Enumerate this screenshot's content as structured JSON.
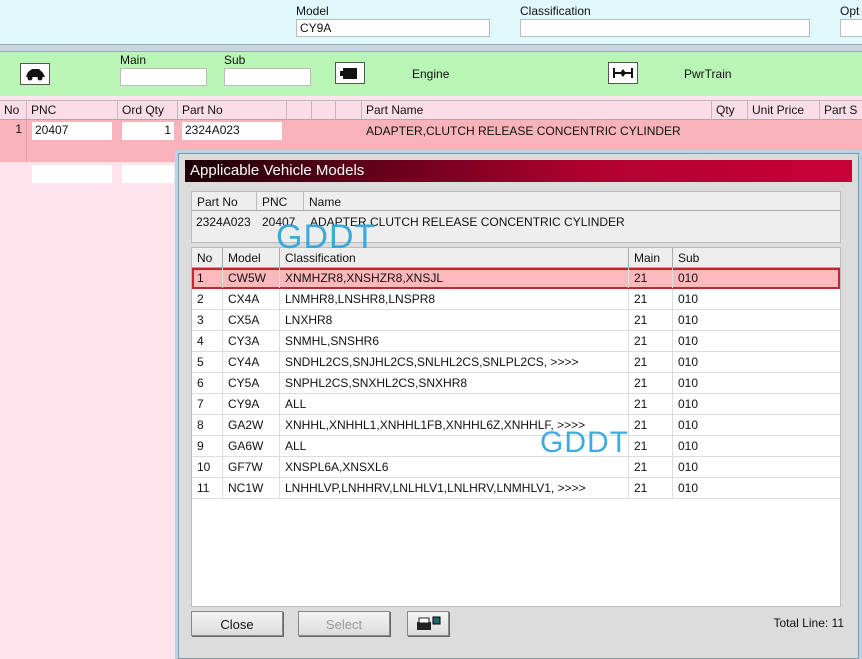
{
  "top": {
    "model_label": "Model",
    "model_value": "CY9A",
    "classification_label": "Classification",
    "classification_value": "",
    "opt_label": "Opt"
  },
  "filter": {
    "main_label": "Main",
    "sub_label": "Sub",
    "engine_label": "Engine",
    "pwrtrain_label": "PwrTrain"
  },
  "grid": {
    "headers": [
      "No",
      "PNC",
      "Ord Qty",
      "Part No",
      "",
      "",
      "",
      "Part Name",
      "Qty",
      "Unit Price",
      "Part S"
    ],
    "row": {
      "no": "1",
      "pnc": "20407",
      "ord_qty": "1",
      "part_no": "2324A023",
      "part_name": "ADAPTER,CLUTCH RELEASE CONCENTRIC CYLINDER"
    }
  },
  "dialog": {
    "title": "Applicable Vehicle Models",
    "info_headers": [
      "Part No",
      "PNC",
      "Name"
    ],
    "info": {
      "part_no": "2324A023",
      "pnc": "20407",
      "name": "ADAPTER,CLUTCH RELEASE CONCENTRIC CYLINDER"
    },
    "headers": [
      "No",
      "Model",
      "Classification",
      "Main",
      "Sub"
    ],
    "rows": [
      [
        "1",
        "CW5W",
        "XNMHZR8,XNSHZR8,XNSJL",
        "21",
        "010"
      ],
      [
        "2",
        "CX4A",
        "LNMHR8,LNSHR8,LNSPR8",
        "21",
        "010"
      ],
      [
        "3",
        "CX5A",
        "LNXHR8",
        "21",
        "010"
      ],
      [
        "4",
        "CY3A",
        "SNMHL,SNSHR6",
        "21",
        "010"
      ],
      [
        "5",
        "CY4A",
        "SNDHL2CS,SNJHL2CS,SNLHL2CS,SNLPL2CS,  >>>>",
        "21",
        "010"
      ],
      [
        "6",
        "CY5A",
        "SNPHL2CS,SNXHL2CS,SNXHR8",
        "21",
        "010"
      ],
      [
        "7",
        "CY9A",
        "ALL",
        "21",
        "010"
      ],
      [
        "8",
        "GA2W",
        "XNHHL,XNHHL1,XNHHL1FB,XNHHL6Z,XNHHLF,  >>>>",
        "21",
        "010"
      ],
      [
        "9",
        "GA6W",
        "ALL",
        "21",
        "010"
      ],
      [
        "10",
        "GF7W",
        "XNSPL6A,XNSXL6",
        "21",
        "010"
      ],
      [
        "11",
        "NC1W",
        "LNHHLVP,LNHHRV,LNLHLV1,LNLHRV,LNMHLV1,  >>>>",
        "21",
        "010"
      ]
    ],
    "close_label": "Close",
    "select_label": "Select",
    "total_line": "Total Line: 11"
  },
  "watermarks": [
    "GDDT",
    "GDDT"
  ]
}
